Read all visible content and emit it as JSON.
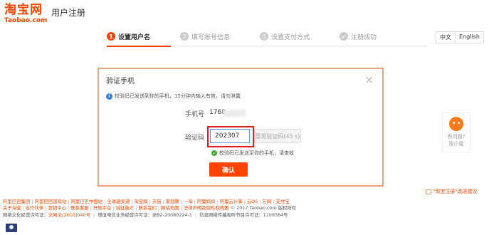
{
  "header": {
    "logo_cn": "淘宝网",
    "logo_en": "Taobao.com",
    "title": "用户注册"
  },
  "steps": [
    {
      "num": "1",
      "label": "设置用户名",
      "state": "active"
    },
    {
      "num": "2",
      "label": "填写账号信息",
      "state": "todo"
    },
    {
      "num": "3",
      "label": "设置支付方式",
      "state": "todo"
    },
    {
      "num": "✓",
      "label": "注册成功",
      "state": "todo"
    }
  ],
  "progress": 0.2,
  "lang": {
    "zh": "中文",
    "en": "English"
  },
  "dialog": {
    "title": "验证手机",
    "close": "×",
    "info": "校验码已发送到你的手机，15分钟内输入有效，请勿泄露",
    "phone_label": "手机号",
    "phone_value": "1768",
    "code_label": "验证码",
    "code_value": "202307",
    "resend_label": "重发验证码(45 s)",
    "sent_note": "校验码已发送至你的手机，请查收",
    "confirm_label": "确认"
  },
  "help": {
    "line1": "有问题?",
    "line2": "找小蜜"
  },
  "feedback": "\"淘宝注册\"改进建议",
  "footer": {
    "links1": [
      "阿里巴巴集团",
      "阿里巴巴国际站",
      "阿里巴巴中国站",
      "全球速卖通",
      "淘宝网",
      "天猫",
      "聚划算",
      "一淘",
      "阿里妈妈",
      "阿里云计算",
      "云OS",
      "万网",
      "支付宝"
    ],
    "links2": [
      "关于淘宝",
      "合作伙伴",
      "营销中心",
      "联系客服",
      "开放平台",
      "诚征英才",
      "联系我们",
      "网站地图",
      "法律声明及隐私权政策"
    ],
    "copyright": "© 2017 Taobao.com 版权所有",
    "lic_a": "网络文化经营许可证：",
    "lic_a_link": "文网文[2010]040号",
    "lic_b": "增值电信业务经营许可证：浙B2-20080224-1",
    "lic_c": "信息网络传播视听节目许可证：1109364号"
  },
  "colors": {
    "brand": "#ff4400",
    "link": "#ff4400",
    "success": "#3fae29",
    "alert": "#e02020"
  },
  "icons": {
    "info": "info-icon",
    "check": "check-icon",
    "close": "close-icon",
    "help": "help-avatar-icon"
  }
}
